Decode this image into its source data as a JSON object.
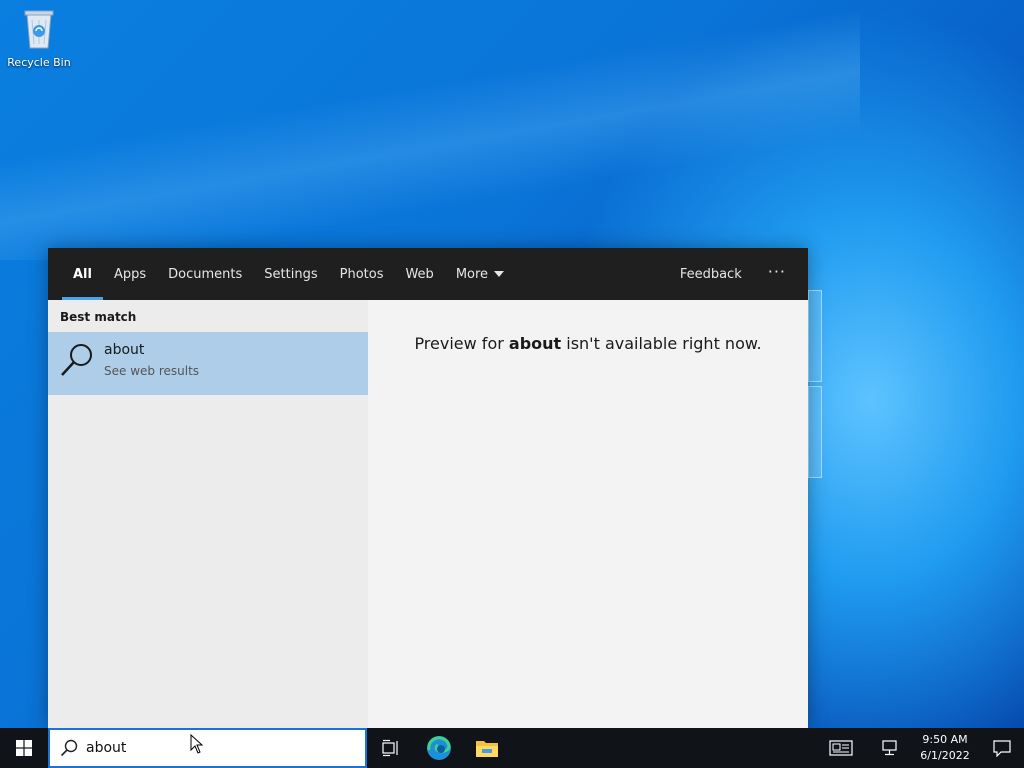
{
  "desktop": {
    "recycle_bin_label": "Recycle Bin"
  },
  "search_flyout": {
    "tabs": [
      {
        "label": "All",
        "active": true
      },
      {
        "label": "Apps"
      },
      {
        "label": "Documents"
      },
      {
        "label": "Settings"
      },
      {
        "label": "Photos"
      },
      {
        "label": "Web"
      },
      {
        "label": "More"
      }
    ],
    "feedback_label": "Feedback",
    "more_options_label": "···",
    "best_match_label": "Best match",
    "best_match": {
      "title": "about",
      "subtitle": "See web results",
      "icon": "search-icon"
    },
    "preview": {
      "prefix": "Preview for ",
      "query": "about",
      "suffix": " isn't available right now."
    }
  },
  "taskbar": {
    "search_value": "about",
    "icons": [
      "windows-start-icon",
      "task-view-icon",
      "edge-icon",
      "file-explorer-icon"
    ],
    "clock_time": "9:50 AM",
    "clock_date": "6/1/2022",
    "tray_icons": [
      "news-icon",
      "network-icon",
      "notification-icon"
    ]
  },
  "colors": {
    "flyout_header": "#1f1f1f",
    "selected_result": "#aecde9",
    "tab_underline": "#4aa3e6",
    "taskbar": "#101318"
  }
}
